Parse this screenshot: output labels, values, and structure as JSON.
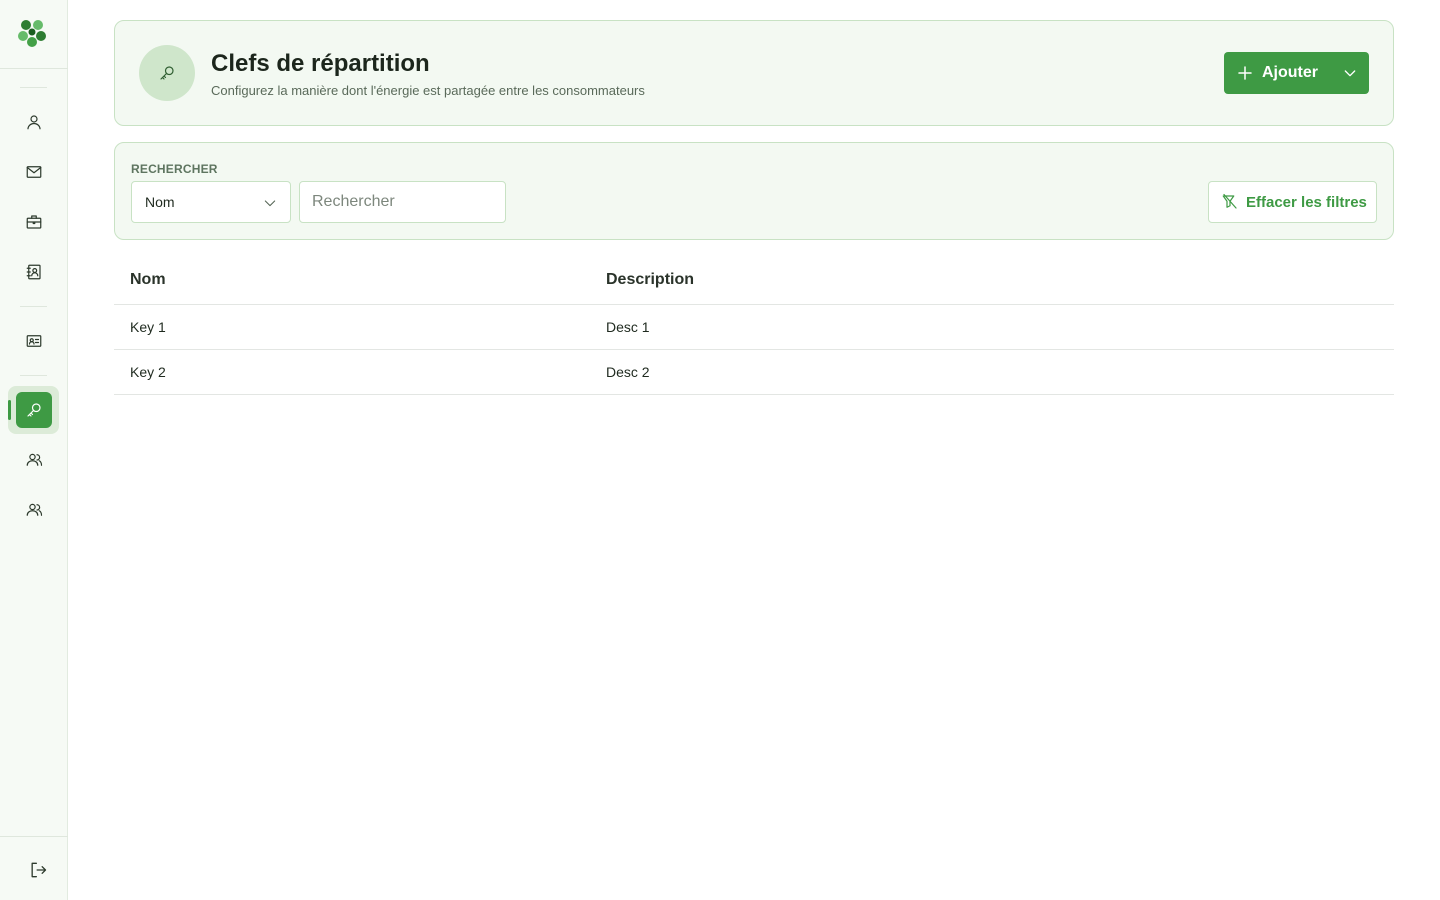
{
  "sidebar": {
    "items": [
      {
        "icon": "user-icon"
      },
      {
        "icon": "mail-icon"
      },
      {
        "icon": "briefcase-icon"
      },
      {
        "icon": "contacts-book-icon"
      },
      {
        "icon": "id-card-icon"
      },
      {
        "icon": "key-icon",
        "active": true
      },
      {
        "icon": "users-icon"
      },
      {
        "icon": "users-icon"
      }
    ],
    "logout_icon": "logout-icon",
    "accent_color": "#3e9a44"
  },
  "header": {
    "title": "Clefs de répartition",
    "subtitle": "Configurez la manière dont l'énergie est partagée entre les consommateurs",
    "add_label": "Ajouter"
  },
  "filters": {
    "label": "RECHERCHER",
    "field_selected": "Nom",
    "search_placeholder": "Rechercher",
    "clear_label": "Effacer les filtres"
  },
  "table": {
    "columns": [
      "Nom",
      "Description"
    ],
    "rows": [
      {
        "name": "Key 1",
        "description": "Desc 1"
      },
      {
        "name": "Key 2",
        "description": "Desc 2"
      }
    ]
  }
}
